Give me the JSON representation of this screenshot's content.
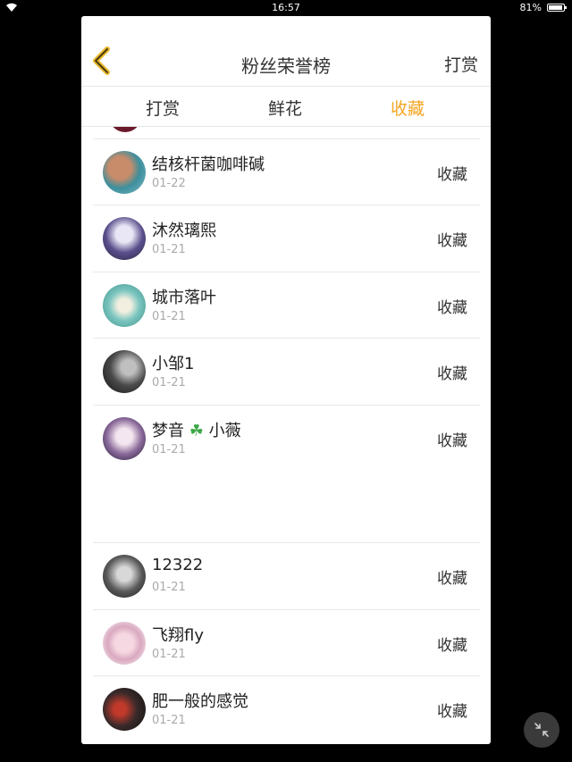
{
  "status": {
    "time": "16:57",
    "battery": "81%",
    "battery_level": 0.81
  },
  "header": {
    "title": "粉丝荣誉榜",
    "action_label": "打赏"
  },
  "tabs": [
    {
      "label": "打赏",
      "active": false
    },
    {
      "label": "鲜花",
      "active": false
    },
    {
      "label": "收藏",
      "active": true
    }
  ],
  "accent_color": "#f5a623",
  "rows": [
    {
      "name": "结核杆菌咖啡碱",
      "date": "01-22",
      "action": "收藏"
    },
    {
      "name": "沐然璃熙",
      "date": "01-21",
      "action": "收藏"
    },
    {
      "name": "城市落叶",
      "date": "01-21",
      "action": "收藏"
    },
    {
      "name": "小邹1",
      "date": "01-21",
      "action": "收藏"
    },
    {
      "name": "梦音",
      "name_suffix": "小薇",
      "date": "01-21",
      "action": "收藏",
      "icon": "clover-icon"
    },
    {
      "name": "12322",
      "date": "01-21",
      "action": "收藏"
    },
    {
      "name": "飞翔fly",
      "date": "01-21",
      "action": "收藏"
    },
    {
      "name": "肥一般的感觉",
      "date": "01-21",
      "action": "收藏"
    }
  ]
}
